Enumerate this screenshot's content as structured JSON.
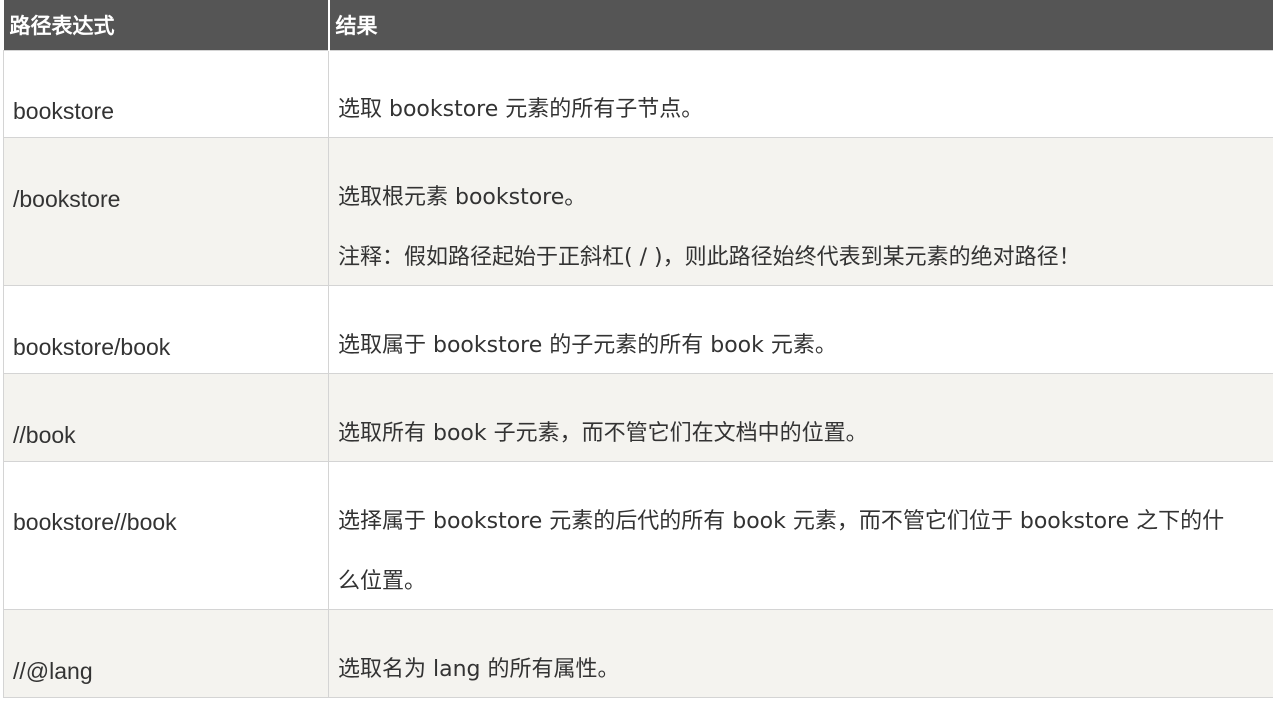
{
  "table": {
    "headers": [
      "路径表达式",
      "结果"
    ],
    "rows": [
      {
        "expression": "bookstore",
        "result": [
          "选取 bookstore 元素的所有子节点。"
        ]
      },
      {
        "expression": "/bookstore",
        "result": [
          "选取根元素 bookstore。",
          "注释：假如路径起始于正斜杠( / )，则此路径始终代表到某元素的绝对路径！"
        ]
      },
      {
        "expression": "bookstore/book",
        "result": [
          "选取属于 bookstore 的子元素的所有 book 元素。"
        ]
      },
      {
        "expression": "//book",
        "result": [
          "选取所有 book 子元素，而不管它们在文档中的位置。"
        ]
      },
      {
        "expression": "bookstore//book",
        "result": [
          "选择属于 bookstore 元素的后代的所有 book 元素，而不管它们位于 bookstore 之下的什",
          "么位置。"
        ]
      },
      {
        "expression": "//@lang",
        "result": [
          "选取名为 lang 的所有属性。"
        ]
      }
    ]
  }
}
